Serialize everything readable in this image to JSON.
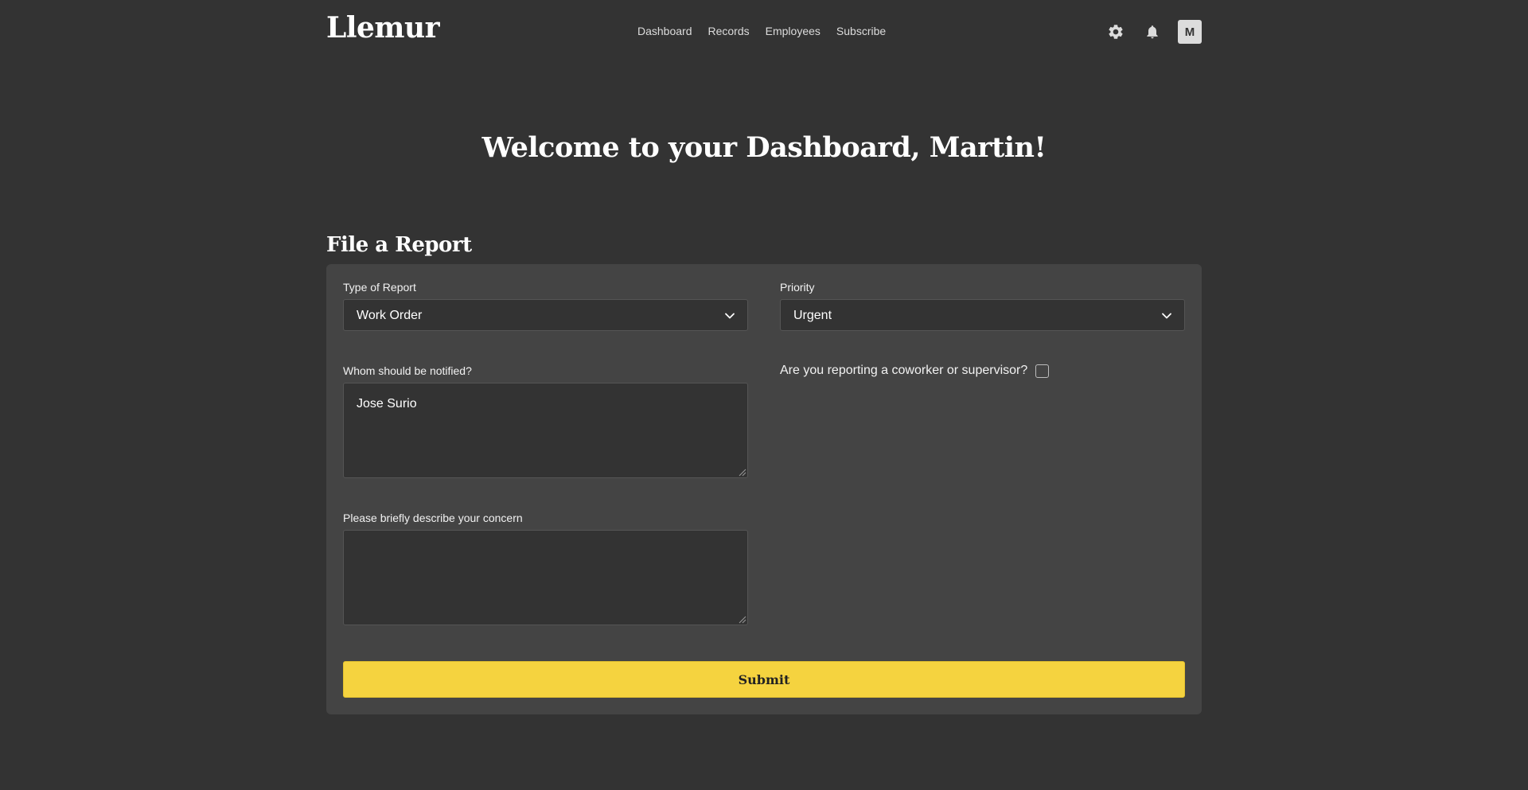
{
  "brand": "Llemur",
  "nav": {
    "items": [
      {
        "label": "Dashboard"
      },
      {
        "label": "Records"
      },
      {
        "label": "Employees"
      },
      {
        "label": "Subscribe"
      }
    ]
  },
  "header": {
    "icons": [
      "gear-icon",
      "bell-icon"
    ],
    "avatar_initial": "M"
  },
  "welcome_title": "Welcome to your Dashboard, Martin!",
  "report": {
    "title": "File a Report",
    "type_label": "Type of Report",
    "type_value": "Work Order",
    "priority_label": "Priority",
    "priority_value": "Urgent",
    "notify_label": "Whom should be notified?",
    "notify_value": "Jose Surio",
    "coworker_label": "Are you reporting a coworker or supervisor?",
    "coworker_checked": false,
    "concern_label": "Please briefly describe your concern",
    "concern_value": "",
    "submit_label": "Submit"
  },
  "colors": {
    "background": "#333333",
    "card": "#444444",
    "accent": "#f5d33f"
  }
}
